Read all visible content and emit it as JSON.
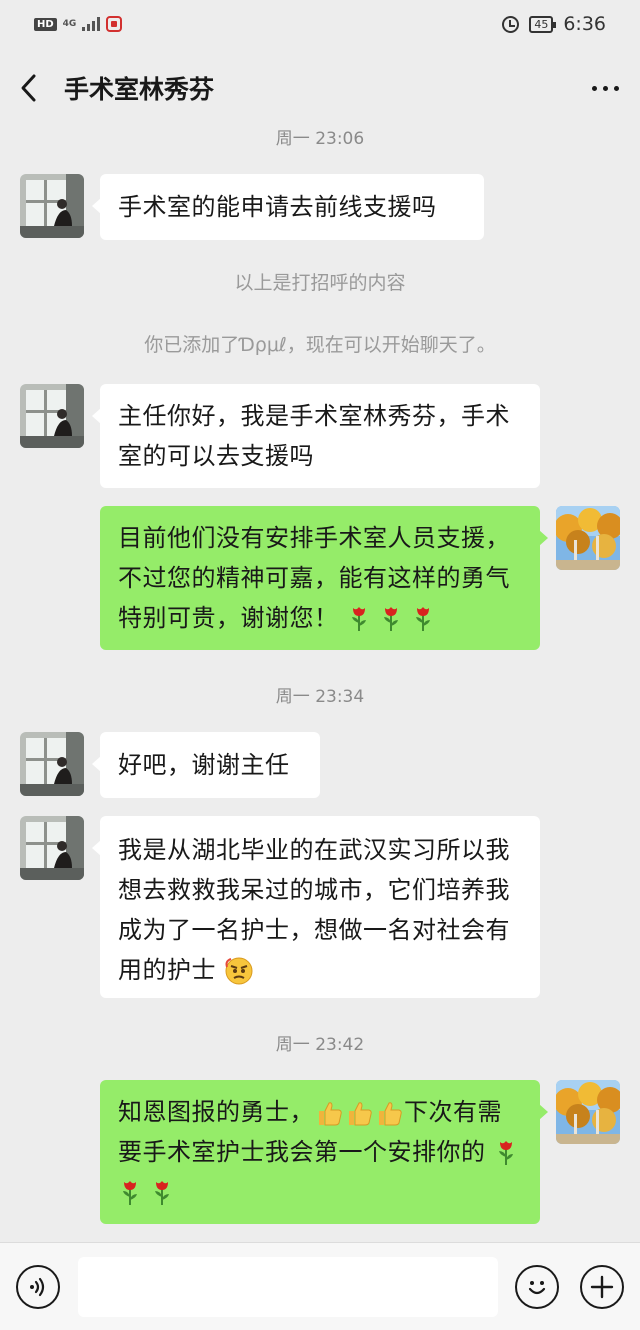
{
  "status_bar": {
    "hd": "HD",
    "network": "4G",
    "battery": "45",
    "time": "6:36"
  },
  "header": {
    "title": "手术室林秀芬"
  },
  "messages": {
    "t1": "周一 23:06",
    "m1": "手术室的能申请去前线支援吗",
    "s1": "以上是打招呼的内容",
    "s2": "你已添加了Ɗρμℓ，现在可以开始聊天了。",
    "m2": "主任你好，我是手术室林秀芬，手术室的可以去支援吗",
    "m3": "目前他们没有安排手术室人员支援，不过您的精神可嘉，能有这样的勇气特别可贵，谢谢您！",
    "t2": "周一 23:34",
    "m4": "好吧，谢谢主任",
    "m5": "我是从湖北毕业的在武汉实习所以我想去救救我呆过的城市，它们培养我成为了一名护士，想做一名对社会有用的护士",
    "t3": "周一 23:42",
    "m6a": "知恩图报的勇士，",
    "m6b": "下次有需要手术室护士我会第一个安排你的"
  },
  "icons": {
    "rose": "rose-emoji",
    "thumbs_up": "thumbs-up-emoji",
    "angry_face": "angry-face-emoji"
  },
  "colors": {
    "background": "#ededed",
    "bubble_self": "#95ec69",
    "bubble_other": "#ffffff"
  },
  "input": {
    "value": ""
  }
}
